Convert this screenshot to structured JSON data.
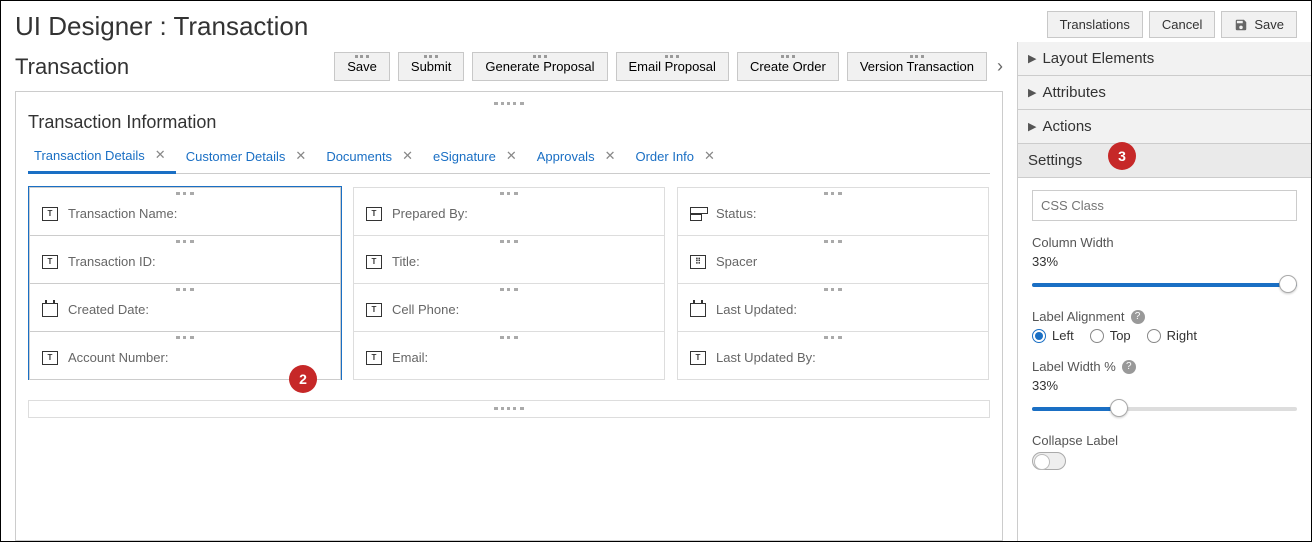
{
  "header": {
    "title": "UI Designer : Transaction",
    "translations": "Translations",
    "cancel": "Cancel",
    "save": "Save"
  },
  "section": {
    "title": "Transaction",
    "actions": [
      "Save",
      "Submit",
      "Generate Proposal",
      "Email Proposal",
      "Create Order",
      "Version Transaction"
    ]
  },
  "panel": {
    "title": "Transaction Information",
    "tabs": [
      {
        "label": "Transaction Details",
        "active": true
      },
      {
        "label": "Customer Details",
        "active": false
      },
      {
        "label": "Documents",
        "active": false
      },
      {
        "label": "eSignature",
        "active": false
      },
      {
        "label": "Approvals",
        "active": false
      },
      {
        "label": "Order Info",
        "active": false
      }
    ],
    "columns": [
      [
        {
          "icon": "text",
          "label": "Transaction Name:"
        },
        {
          "icon": "text",
          "label": "Transaction ID:"
        },
        {
          "icon": "cal",
          "label": "Created Date:"
        },
        {
          "icon": "text",
          "label": "Account Number:"
        }
      ],
      [
        {
          "icon": "text",
          "label": "Prepared By:"
        },
        {
          "icon": "text",
          "label": "Title:"
        },
        {
          "icon": "text",
          "label": "Cell Phone:"
        },
        {
          "icon": "text",
          "label": "Email:"
        }
      ],
      [
        {
          "icon": "status",
          "label": "Status:"
        },
        {
          "icon": "spacer",
          "label": "Spacer"
        },
        {
          "icon": "cal",
          "label": "Last Updated:"
        },
        {
          "icon": "text",
          "label": "Last Updated By:"
        }
      ]
    ]
  },
  "sidebar": {
    "sections": [
      "Layout Elements",
      "Attributes",
      "Actions",
      "Settings"
    ],
    "settings": {
      "css_placeholder": "CSS Class",
      "column_width_label": "Column Width",
      "column_width_value": "33%",
      "column_width_pct": 100,
      "label_alignment_label": "Label Alignment",
      "label_alignment_options": [
        "Left",
        "Top",
        "Right"
      ],
      "label_alignment_value": "Left",
      "label_width_label": "Label Width %",
      "label_width_value": "33%",
      "label_width_pct": 33,
      "collapse_label": "Collapse Label"
    }
  },
  "badges": {
    "b2": "2",
    "b3": "3"
  }
}
